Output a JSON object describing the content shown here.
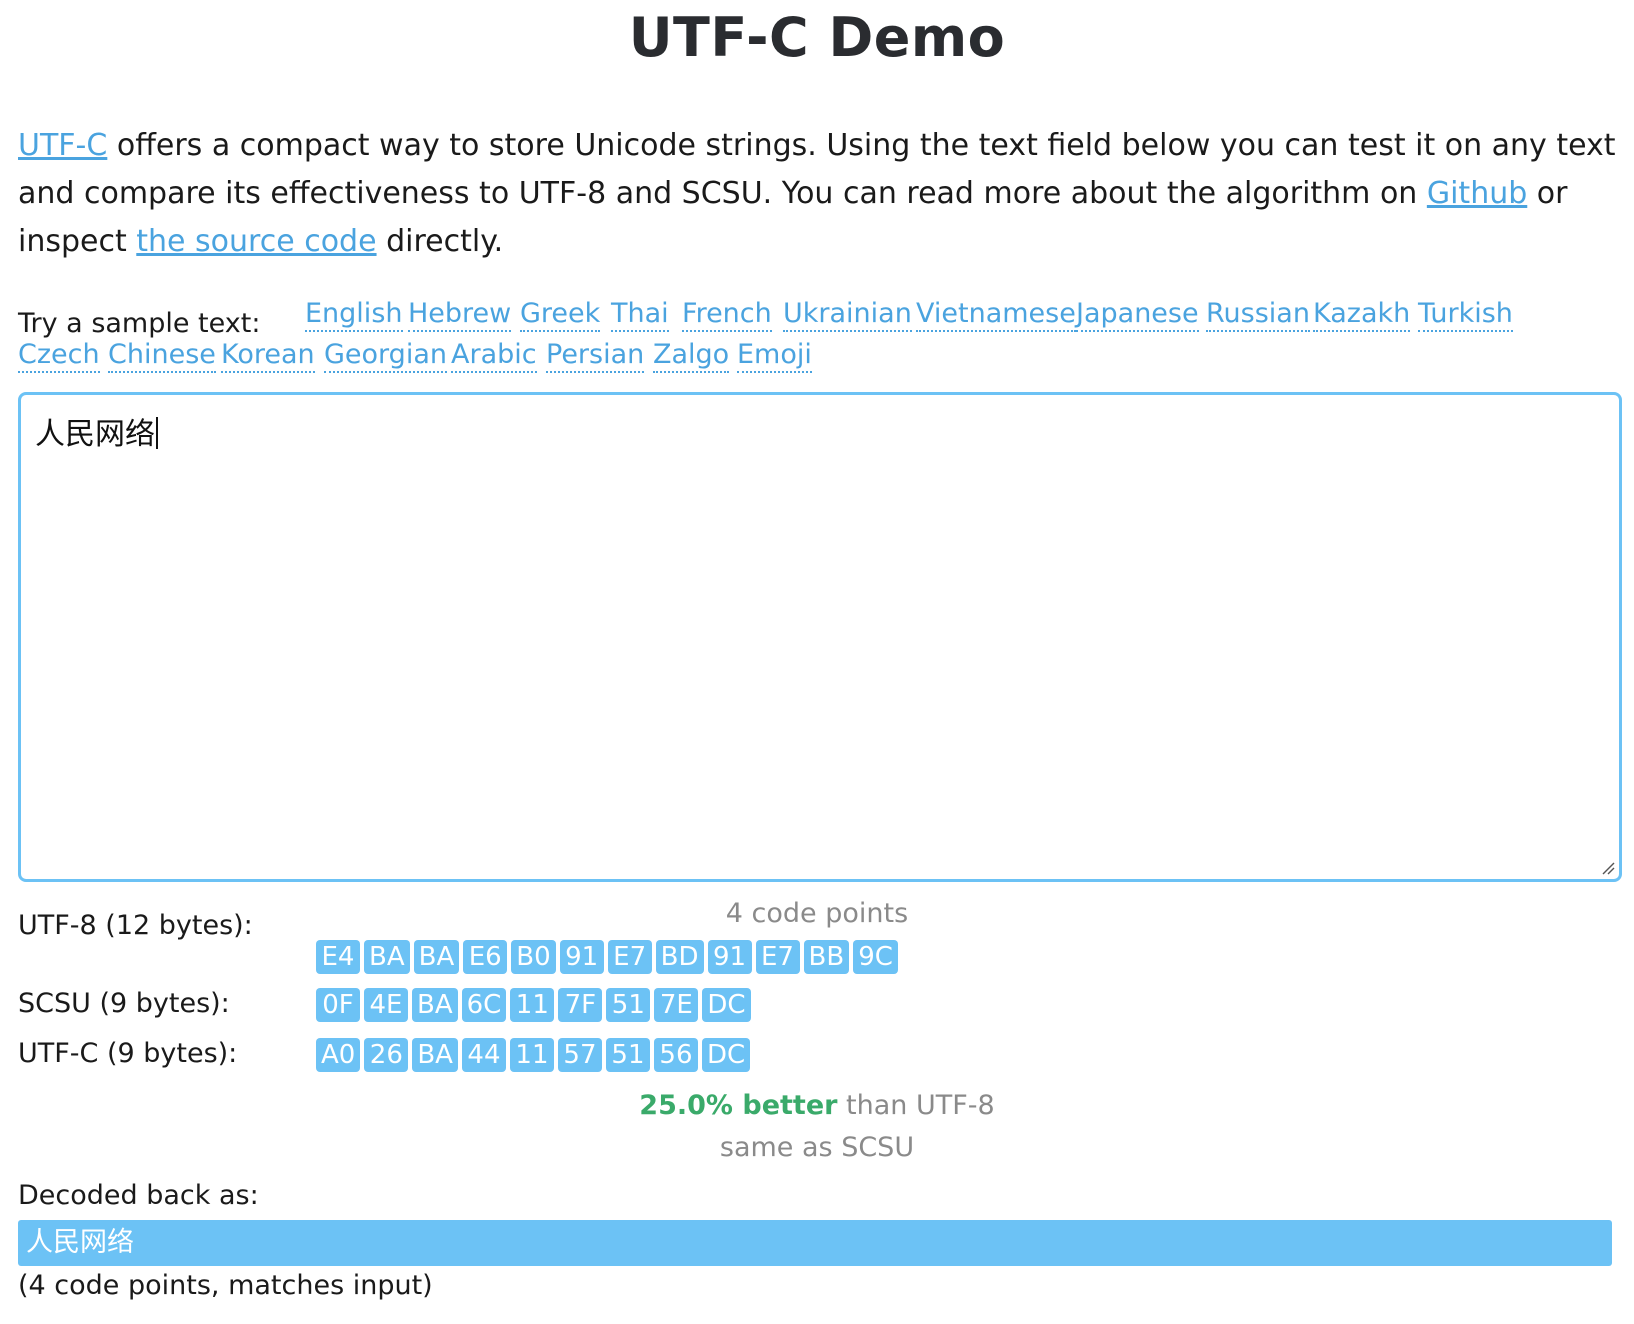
{
  "title": "UTF-C Demo",
  "intro": {
    "link_utfc": "UTF-C",
    "text1": " offers a compact way to store Unicode strings. Using the text field below you can test it on any text and compare its effectiveness to UTF-8 and SCSU. You can read more about the algorithm on ",
    "link_github": "Github",
    "text2": " or inspect ",
    "link_source": "the source code",
    "text3": " directly."
  },
  "samples": {
    "label": "Try a sample text:",
    "items": [
      "English",
      "Hebrew",
      "Greek",
      "Thai",
      "French",
      "Ukrainian",
      "Vietnamese",
      "Japanese",
      "Russian",
      "Kazakh",
      "Turkish",
      "Czech",
      "Chinese",
      "Korean",
      "Georgian",
      "Arabic",
      "Persian",
      "Zalgo",
      "Emoji"
    ]
  },
  "editor": {
    "value": "人民网络"
  },
  "code_points": "4 code points",
  "encodings": {
    "utf8": {
      "label": "UTF-8 (12 bytes):",
      "bytes": [
        "E4",
        "BA",
        "BA",
        "E6",
        "B0",
        "91",
        "E7",
        "BD",
        "91",
        "E7",
        "BB",
        "9C"
      ]
    },
    "scsu": {
      "label": "SCSU (9 bytes):",
      "bytes": [
        "0F",
        "4E",
        "BA",
        "6C",
        "11",
        "7F",
        "51",
        "7E",
        "DC"
      ]
    },
    "utfc": {
      "label": "UTF-C (9 bytes):",
      "bytes": [
        "A0",
        "26",
        "BA",
        "44",
        "11",
        "57",
        "51",
        "56",
        "DC"
      ]
    }
  },
  "comparison": {
    "better": "25.0% better",
    "vs_utf8": " than UTF-8",
    "vs_scsu": "same as SCSU",
    "better_color": "#3aaa6a"
  },
  "decoded": {
    "label": "Decoded back as:",
    "value": "人民网络",
    "note": "(4 code points, matches input)"
  },
  "colors": {
    "accent": "#6cc2f5",
    "link": "#4aa3df",
    "muted": "#8a8a8a"
  }
}
